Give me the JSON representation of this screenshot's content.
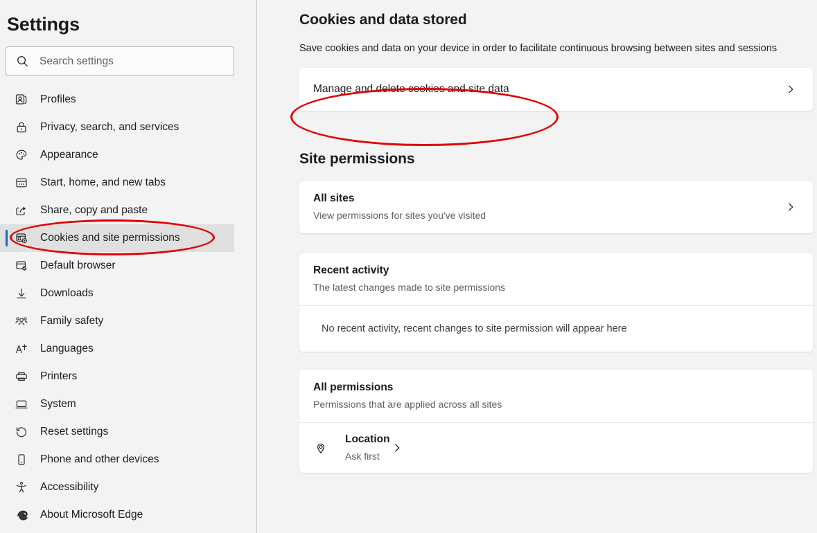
{
  "sidebar": {
    "title": "Settings",
    "search": {
      "placeholder": "Search settings",
      "value": "",
      "icon": "search-icon"
    },
    "items": [
      {
        "label": "Profiles",
        "icon": "profiles-icon",
        "selected": false
      },
      {
        "label": "Privacy, search, and services",
        "icon": "lock-icon",
        "selected": false
      },
      {
        "label": "Appearance",
        "icon": "palette-icon",
        "selected": false
      },
      {
        "label": "Start, home, and new tabs",
        "icon": "new-tab-icon",
        "selected": false
      },
      {
        "label": "Share, copy and paste",
        "icon": "share-icon",
        "selected": false
      },
      {
        "label": "Cookies and site permissions",
        "icon": "cookies-icon",
        "selected": true
      },
      {
        "label": "Default browser",
        "icon": "default-browser-icon",
        "selected": false
      },
      {
        "label": "Downloads",
        "icon": "download-icon",
        "selected": false
      },
      {
        "label": "Family safety",
        "icon": "family-icon",
        "selected": false
      },
      {
        "label": "Languages",
        "icon": "languages-icon",
        "selected": false
      },
      {
        "label": "Printers",
        "icon": "printer-icon",
        "selected": false
      },
      {
        "label": "System",
        "icon": "system-icon",
        "selected": false
      },
      {
        "label": "Reset settings",
        "icon": "reset-icon",
        "selected": false
      },
      {
        "label": "Phone and other devices",
        "icon": "phone-icon",
        "selected": false
      },
      {
        "label": "Accessibility",
        "icon": "accessibility-icon",
        "selected": false
      },
      {
        "label": "About Microsoft Edge",
        "icon": "edge-logo-icon",
        "selected": false
      }
    ]
  },
  "main": {
    "cookies_section": {
      "title": "Cookies and data stored",
      "description": "Save cookies and data on your device in order to facilitate continuous browsing between sites and sessions",
      "manage_row": {
        "label": "Manage and delete cookies and site data",
        "chevron": "chevron-right-icon"
      }
    },
    "site_permissions_section": {
      "title": "Site permissions",
      "all_sites": {
        "title": "All sites",
        "subtitle": "View permissions for sites you've visited",
        "chevron": "chevron-right-icon"
      },
      "recent_activity": {
        "title": "Recent activity",
        "subtitle": "The latest changes made to site permissions",
        "empty_text": "No recent activity, recent changes to site permission will appear here"
      },
      "all_permissions": {
        "title": "All permissions",
        "subtitle": "Permissions that are applied across all sites",
        "permissions": [
          {
            "name": "Location",
            "state": "Ask first",
            "icon": "location-icon",
            "chevron": "chevron-right-icon"
          }
        ]
      }
    }
  },
  "annotations": {
    "accent_color": "#0f6cbd",
    "highlight_color": "#e00000",
    "sidebar_highlight_target": "Cookies and site permissions",
    "main_highlight_target": "Manage and delete cookies and site data"
  }
}
